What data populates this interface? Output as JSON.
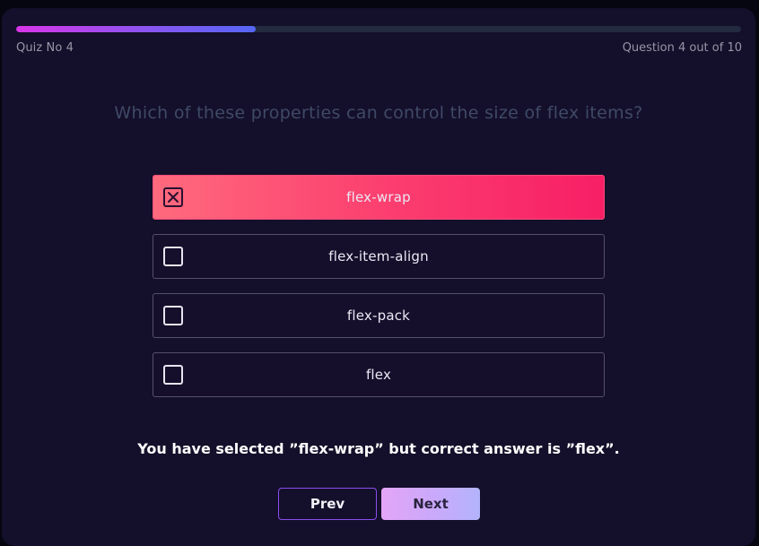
{
  "progress": {
    "fraction": 0.33,
    "fill_gradient": [
      "#d836e8",
      "#5567f6"
    ]
  },
  "header": {
    "quiz_no": "Quiz No 4",
    "question_counter": "Question 4 out of 10"
  },
  "question": {
    "text": "Which of these properties can control the size of flex items?"
  },
  "options": [
    {
      "label": "flex-wrap",
      "selected": true
    },
    {
      "label": "flex-item-align",
      "selected": false
    },
    {
      "label": "flex-pack",
      "selected": false
    },
    {
      "label": "flex",
      "selected": false
    }
  ],
  "feedback": {
    "text": "You have selected ”flex-wrap” but correct answer is ”flex”."
  },
  "nav": {
    "prev_label": "Prev",
    "next_label": "Next"
  },
  "colors": {
    "card_bg": "#140f2a",
    "selected_option": "#fb3c6e",
    "accent_border": "#8a4ef0"
  },
  "icons": {
    "selected_checkbox": "x-checkbox-icon",
    "unselected_checkbox": "empty-checkbox-icon"
  }
}
